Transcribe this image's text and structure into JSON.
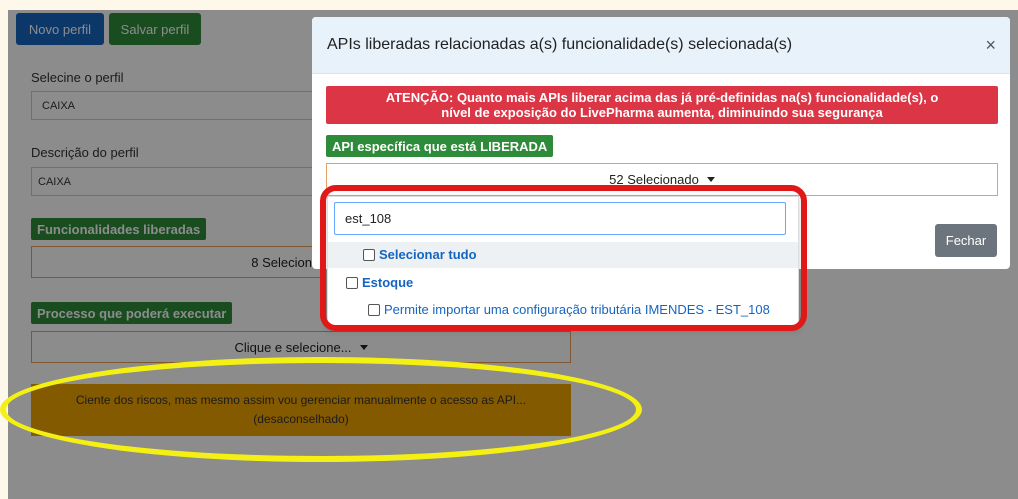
{
  "toolbar": {
    "new_profile": "Novo perfil",
    "save_profile": "Salvar perfil"
  },
  "profile_select": {
    "label": "Selecine o perfil",
    "value": "CAIXA"
  },
  "profile_description": {
    "label": "Descrição do perfil",
    "value": "CAIXA"
  },
  "functionalities": {
    "label": "Funcionalidades liberadas",
    "value": "8 Selecion"
  },
  "process": {
    "label": "Processo que poderá executar",
    "value": "Clique e selecione..."
  },
  "risk_button": {
    "line1": "Ciente dos riscos, mas mesmo assim vou gerenciar manualmente o acesso as API...",
    "line2": "(desaconselhado)"
  },
  "modal": {
    "title": "APIs liberadas relacionadas a(s) funcionalidade(s) selecionada(s)",
    "close": "×",
    "alert_line1": "ATENÇÃO: Quanto mais APIs liberar acima das já pré-definidas na(s) funcionalidade(s), o",
    "alert_line2": "nível de exposição do LivePharma aumenta, diminuindo sua segurança",
    "api_badge": "API específica que está LIBERADA",
    "selected_count": "52 Selecionado",
    "close_button": "Fechar"
  },
  "dropdown": {
    "search_value": "est_108",
    "select_all": "Selecionar tudo",
    "group": "Estoque",
    "option": "Permite importar uma configuração tributária IMENDES - EST_108"
  },
  "colors": {
    "primary": "#1565c0",
    "success": "#2e8b3a",
    "danger": "#dc3545",
    "warning": "#f0a400",
    "annotation_red": "#e01818",
    "annotation_yellow": "#f5f014"
  }
}
